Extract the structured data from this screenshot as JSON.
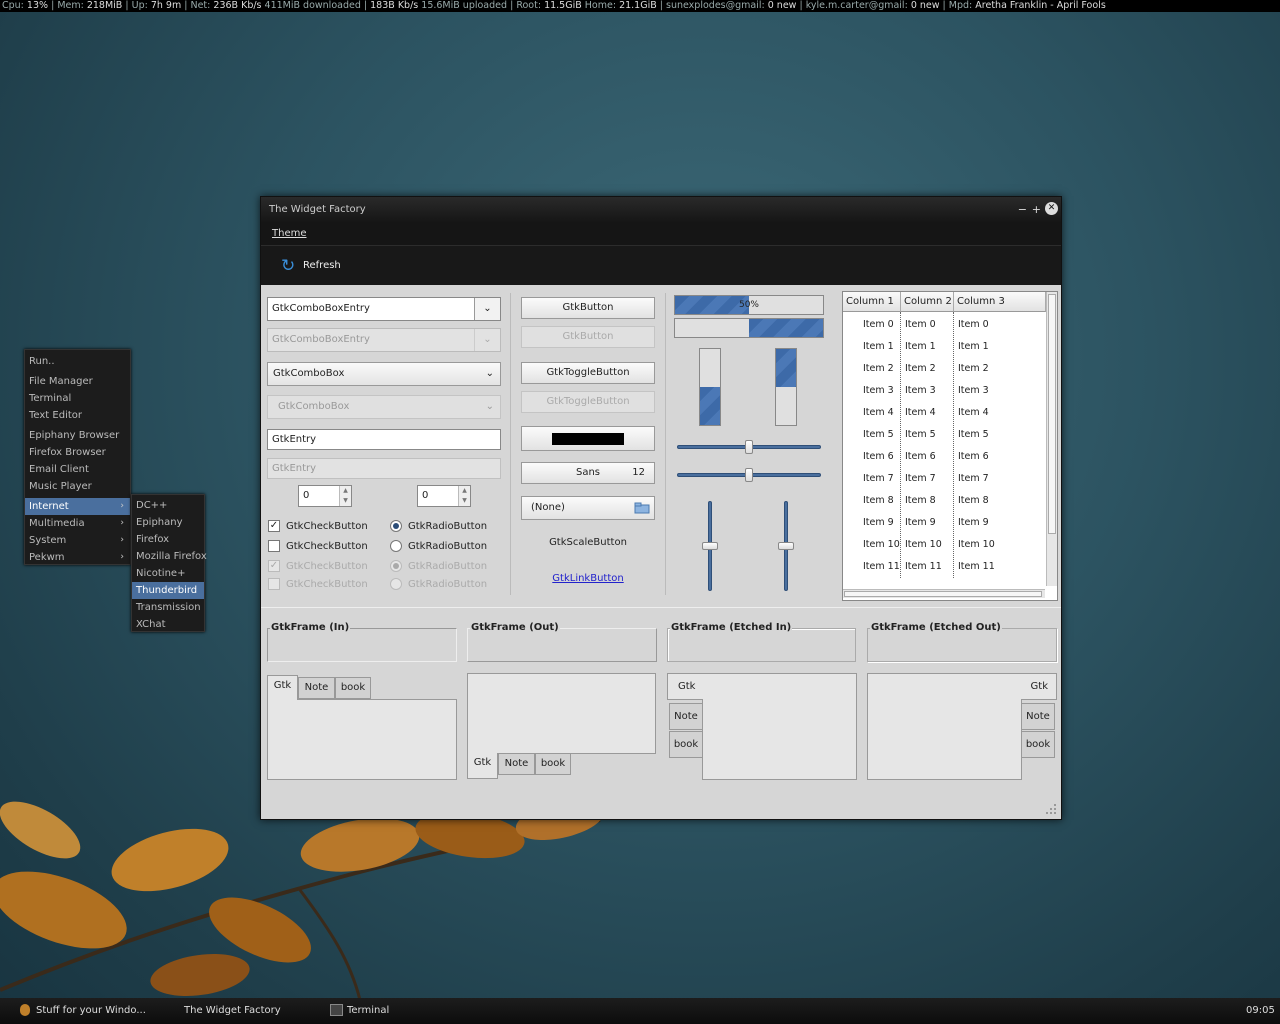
{
  "statusbar": {
    "cpu_label": "Cpu:",
    "cpu": "13%",
    "mem_label": "Mem:",
    "mem": "218MiB",
    "up_label": "Up:",
    "up": "7h 9m",
    "net_label": "Net:",
    "net_down": "236B",
    "net_down_unit": "Kb/s",
    "downloaded": "411MiB downloaded",
    "net_up": "183B",
    "net_up_unit": "Kb/s",
    "uploaded": "15.6MiB uploaded",
    "root_label": "Root:",
    "root": "11.5GiB",
    "home_label": "Home:",
    "home": "21.1GiB",
    "mail1_label": "sunexplodes@gmail:",
    "mail1": "0 new",
    "mail2_label": "kyle.m.carter@gmail:",
    "mail2": "0 new",
    "mpd_label": "Mpd:",
    "mpd": "Aretha Franklin - April Fools",
    "sep": "|"
  },
  "menu": {
    "items": [
      "Run..",
      "File Manager",
      "Terminal",
      "Text Editor",
      "Epiphany Browser",
      "Firefox Browser",
      "Email Client",
      "Music Player",
      "Internet",
      "Multimedia",
      "System",
      "Pekwm"
    ],
    "arrow": "›"
  },
  "submenu": {
    "items": [
      "DC++",
      "Epiphany",
      "Firefox",
      "Mozilla Firefox",
      "Nicotine+",
      "Thunderbird",
      "Transmission",
      "XChat"
    ]
  },
  "window": {
    "title": "The Widget Factory",
    "minimize": "−",
    "maximize": "+",
    "close": "✕",
    "menubar": {
      "theme": "Theme"
    },
    "toolbar": {
      "refresh": "Refresh",
      "refresh_icon": "↻"
    }
  },
  "col1": {
    "combo_entry": "GtkComboBoxEntry",
    "combo_entry_dis": "GtkComboBoxEntry",
    "combo": "GtkComboBox",
    "combo_dis": "GtkComboBox",
    "entry": "GtkEntry",
    "entry_dis": "GtkEntry",
    "spin1": "0",
    "spin2": "0",
    "dd": "⌄",
    "check1": "GtkCheckButton",
    "check2": "GtkCheckButton",
    "check3": "GtkCheckButton",
    "check4": "GtkCheckButton",
    "radio1": "GtkRadioButton",
    "radio2": "GtkRadioButton",
    "radio3": "GtkRadioButton",
    "radio4": "GtkRadioButton",
    "checkmark": "✓"
  },
  "col2": {
    "button": "GtkButton",
    "button_dis": "GtkButton",
    "toggle": "GtkToggleButton",
    "toggle_dis": "GtkToggleButton",
    "font_name": "Sans",
    "font_size": "12",
    "file": "(None)",
    "scale_button": "GtkScaleButton",
    "link": "GtkLinkButton",
    "color_swatch": "#000000"
  },
  "col3": {
    "progress_text": "50%",
    "progress1": 0.5,
    "progress2": 0.5,
    "vprogress1": 0.5,
    "vprogress2": 0.5,
    "hscale1": 0.5,
    "hscale2": 0.5,
    "vscale1": 0.5,
    "vscale2": 0.5
  },
  "tree": {
    "columns": [
      "Column 1",
      "Column 2",
      "Column 3"
    ],
    "rows": [
      [
        "Item 0",
        "Item 0",
        "Item 0"
      ],
      [
        "Item 1",
        "Item 1",
        "Item 1"
      ],
      [
        "Item 2",
        "Item 2",
        "Item 2"
      ],
      [
        "Item 3",
        "Item 3",
        "Item 3"
      ],
      [
        "Item 4",
        "Item 4",
        "Item 4"
      ],
      [
        "Item 5",
        "Item 5",
        "Item 5"
      ],
      [
        "Item 6",
        "Item 6",
        "Item 6"
      ],
      [
        "Item 7",
        "Item 7",
        "Item 7"
      ],
      [
        "Item 8",
        "Item 8",
        "Item 8"
      ],
      [
        "Item 9",
        "Item 9",
        "Item 9"
      ],
      [
        "Item 10",
        "Item 10",
        "Item 10"
      ],
      [
        "Item 11",
        "Item 11",
        "Item 11"
      ]
    ]
  },
  "frames": [
    "GtkFrame (In)",
    "GtkFrame (Out)",
    "GtkFrame (Etched In)",
    "GtkFrame (Etched Out)"
  ],
  "notebook_tabs": [
    "Gtk",
    "Note",
    "book"
  ],
  "taskbar": {
    "task1": "Stuff for your Windo...",
    "task2": "The Widget Factory",
    "task3": "Terminal",
    "clock": "09:05"
  },
  "colors": {
    "accent": "#4a6f9e",
    "desktop": "#2c5361",
    "progress": "#3d6aa8"
  }
}
